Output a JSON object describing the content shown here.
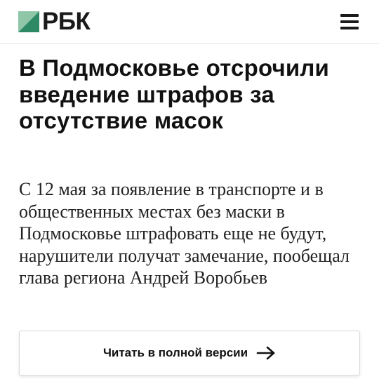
{
  "header": {
    "logo_text": "РБК",
    "logo_icon": "rbc-logo-mark",
    "menu_icon": "hamburger-menu-icon"
  },
  "article": {
    "title": "В Подмосковье отсрочили введение штрафов за отсутствие масок",
    "lead": "С 12 мая за появление в транспорте и в общественных местах без маски в Подмосковье штрафовать еще не будут, нарушители получат замечание, пообещал глава региона Андрей Воробьев"
  },
  "actions": {
    "full_version_label": "Читать в полной версии",
    "full_version_icon": "arrow-right-icon"
  },
  "colors": {
    "logo_green_light": "#8fc6a8",
    "logo_green_dark": "#2e8a64",
    "text": "#111111",
    "border": "#d9d9d9"
  }
}
